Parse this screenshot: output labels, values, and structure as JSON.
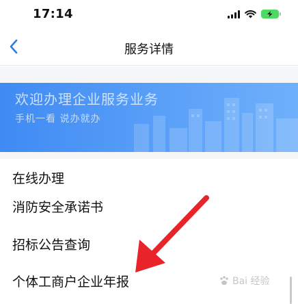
{
  "status_bar": {
    "time": "17:14"
  },
  "nav": {
    "title": "服务详情"
  },
  "banner": {
    "title": "欢迎办理企业服务业务",
    "subtitle": "手机一看 说办就办"
  },
  "section": {
    "title": "在线办理",
    "items": [
      {
        "label": "消防安全承诺书"
      },
      {
        "label": "招标公告查询"
      },
      {
        "label": "个体工商户企业年报"
      }
    ]
  },
  "watermark": {
    "text": "Bai 经验"
  },
  "colors": {
    "banner": "#4a95f6",
    "arrow": "#e8242a",
    "back": "#2f7de1"
  }
}
